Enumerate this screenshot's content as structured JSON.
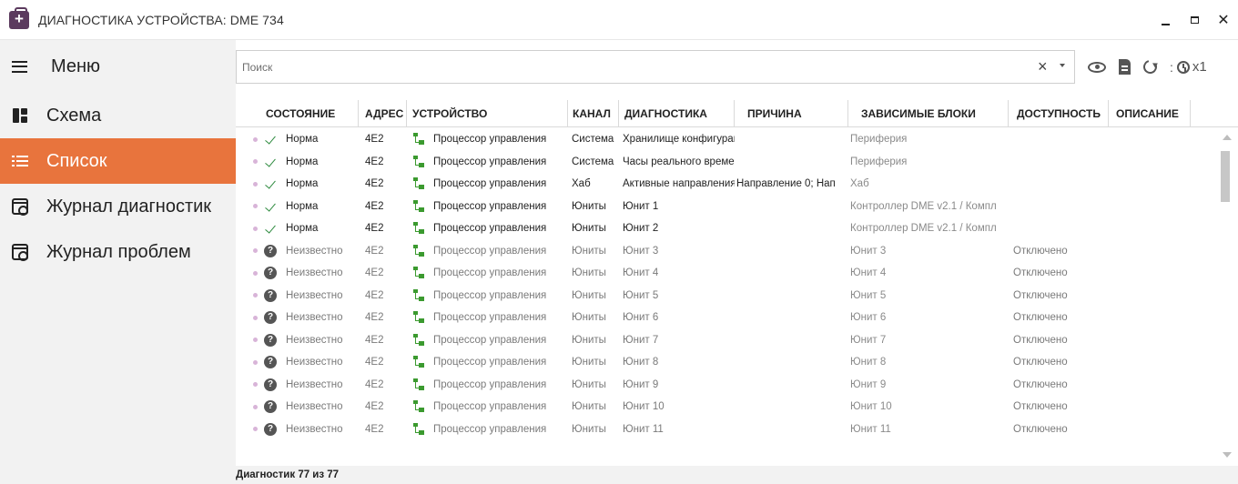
{
  "window": {
    "title": "ДИАГНОСТИКА УСТРОЙСТВА: DME 734",
    "controls": [
      "minimize",
      "maximize",
      "close"
    ]
  },
  "sidebar": {
    "menu_label": "Меню",
    "items": [
      {
        "label": "Схема",
        "icon": "scheme-icon",
        "active": false
      },
      {
        "label": "Список",
        "icon": "list-icon",
        "active": true
      },
      {
        "label": "Журнал диагностик",
        "icon": "journal-icon",
        "active": false
      },
      {
        "label": "Журнал проблем",
        "icon": "journal-icon",
        "active": false
      }
    ],
    "active_color": "#e8743d"
  },
  "search": {
    "placeholder": "Поиск",
    "value": "",
    "clear_glyph": "×"
  },
  "toolbar": {
    "timer_label": "x1",
    "timer_dots": ":"
  },
  "table": {
    "headers": [
      "СОСТОЯНИЕ",
      "АДРЕС",
      "УСТРОЙСТВО",
      "КАНАЛ",
      "ДИАГНОСТИКА",
      "ПРИЧИНА",
      "ЗАВИСИМЫЕ БЛОКИ",
      "ДОСТУПНОСТЬ",
      "ОПИСАНИЕ"
    ],
    "rows": [
      {
        "status": "ok",
        "state": "Норма",
        "address": "4E2",
        "device": "Процессор управления",
        "channel": "Система",
        "diagnostic": "Хранилище конфигурац",
        "reason": "",
        "dependent": "Периферия",
        "availability": "",
        "description": ""
      },
      {
        "status": "ok",
        "state": "Норма",
        "address": "4E2",
        "device": "Процессор управления",
        "channel": "Система",
        "diagnostic": "Часы реального време",
        "reason": "",
        "dependent": "Периферия",
        "availability": "",
        "description": ""
      },
      {
        "status": "ok",
        "state": "Норма",
        "address": "4E2",
        "device": "Процессор управления",
        "channel": "Хаб",
        "diagnostic": "Активные направления",
        "reason": "Направление 0; Нап",
        "dependent": "Хаб",
        "availability": "",
        "description": ""
      },
      {
        "status": "ok",
        "state": "Норма",
        "address": "4E2",
        "device": "Процессор управления",
        "channel": "Юниты",
        "diagnostic": "Юнит 1",
        "reason": "",
        "dependent": "Контроллер DME v2.1 / Компл",
        "availability": "",
        "description": ""
      },
      {
        "status": "ok",
        "state": "Норма",
        "address": "4E2",
        "device": "Процессор управления",
        "channel": "Юниты",
        "diagnostic": "Юнит 2",
        "reason": "",
        "dependent": "Контроллер DME v2.1 / Компл",
        "availability": "",
        "description": ""
      },
      {
        "status": "unknown",
        "state": "Неизвестно",
        "address": "4E2",
        "device": "Процессор управления",
        "channel": "Юниты",
        "diagnostic": "Юнит 3",
        "reason": "",
        "dependent": "Юнит 3",
        "availability": "Отключено",
        "description": ""
      },
      {
        "status": "unknown",
        "state": "Неизвестно",
        "address": "4E2",
        "device": "Процессор управления",
        "channel": "Юниты",
        "diagnostic": "Юнит 4",
        "reason": "",
        "dependent": "Юнит 4",
        "availability": "Отключено",
        "description": ""
      },
      {
        "status": "unknown",
        "state": "Неизвестно",
        "address": "4E2",
        "device": "Процессор управления",
        "channel": "Юниты",
        "diagnostic": "Юнит 5",
        "reason": "",
        "dependent": "Юнит 5",
        "availability": "Отключено",
        "description": ""
      },
      {
        "status": "unknown",
        "state": "Неизвестно",
        "address": "4E2",
        "device": "Процессор управления",
        "channel": "Юниты",
        "diagnostic": "Юнит 6",
        "reason": "",
        "dependent": "Юнит 6",
        "availability": "Отключено",
        "description": ""
      },
      {
        "status": "unknown",
        "state": "Неизвестно",
        "address": "4E2",
        "device": "Процессор управления",
        "channel": "Юниты",
        "diagnostic": "Юнит 7",
        "reason": "",
        "dependent": "Юнит 7",
        "availability": "Отключено",
        "description": ""
      },
      {
        "status": "unknown",
        "state": "Неизвестно",
        "address": "4E2",
        "device": "Процессор управления",
        "channel": "Юниты",
        "diagnostic": "Юнит 8",
        "reason": "",
        "dependent": "Юнит 8",
        "availability": "Отключено",
        "description": ""
      },
      {
        "status": "unknown",
        "state": "Неизвестно",
        "address": "4E2",
        "device": "Процессор управления",
        "channel": "Юниты",
        "diagnostic": "Юнит 9",
        "reason": "",
        "dependent": "Юнит 9",
        "availability": "Отключено",
        "description": ""
      },
      {
        "status": "unknown",
        "state": "Неизвестно",
        "address": "4E2",
        "device": "Процессор управления",
        "channel": "Юниты",
        "diagnostic": "Юнит 10",
        "reason": "",
        "dependent": "Юнит 10",
        "availability": "Отключено",
        "description": ""
      },
      {
        "status": "unknown",
        "state": "Неизвестно",
        "address": "4E2",
        "device": "Процессор управления",
        "channel": "Юниты",
        "diagnostic": "Юнит 11",
        "reason": "",
        "dependent": "Юнит 11",
        "availability": "Отключено",
        "description": ""
      }
    ]
  },
  "statusbar": {
    "text": "Диагностик 77 из 77"
  },
  "colors": {
    "ok_check": "#2d8a3e",
    "device_icon": "#3b9a2f",
    "row_dot": "#d8b4d8"
  }
}
